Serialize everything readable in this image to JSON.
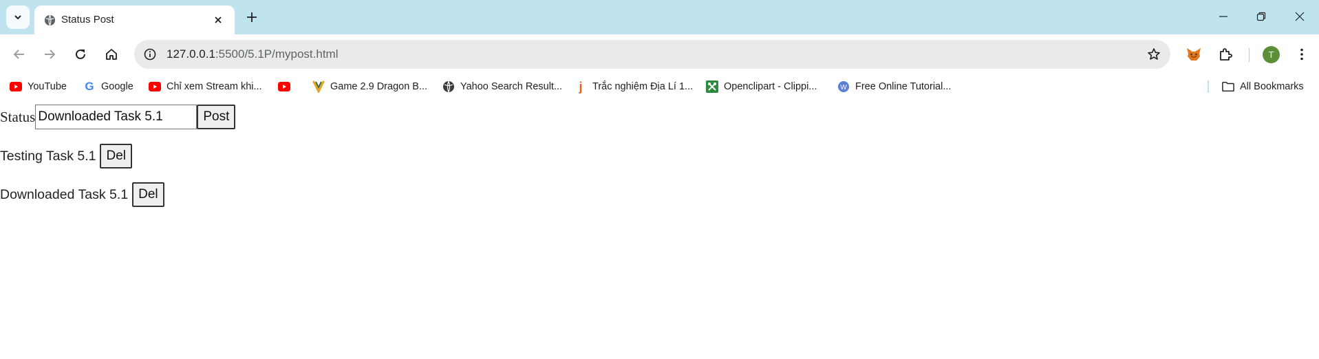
{
  "browser": {
    "tab_title": "Status Post",
    "url_host": "127.0.0.1",
    "url_rest": ":5500/5.1P/mypost.html",
    "avatar_letter": "T",
    "bookmarks": [
      {
        "label": "YouTube",
        "icon": "youtube-icon"
      },
      {
        "label": "Google",
        "icon": "google-icon"
      },
      {
        "label": "Chỉ xem Stream khi...",
        "icon": "youtube-icon"
      },
      {
        "label": "",
        "icon": "youtube-icon"
      },
      {
        "label": "Game 2.9 Dragon B...",
        "icon": "vivaldi-icon"
      },
      {
        "label": "Yahoo Search Result...",
        "icon": "globe-icon"
      },
      {
        "label": "Trắc nghiệm Địa Lí 1...",
        "icon": "j-icon"
      },
      {
        "label": "Openclipart - Clippi...",
        "icon": "openclipart-icon"
      },
      {
        "label": "Free Online Tutorial...",
        "icon": "w-icon"
      }
    ],
    "all_bookmarks_label": "All Bookmarks"
  },
  "page": {
    "status_label": "Status",
    "status_input_value": "Downloaded Task 5.1",
    "post_button_label": "Post",
    "posts": [
      {
        "text": "Testing Task 5.1",
        "delete_label": "Del"
      },
      {
        "text": "Downloaded Task 5.1",
        "delete_label": "Del"
      }
    ]
  },
  "colors": {
    "tabstrip": "#bfe4ef",
    "omnibox": "#e9eaea",
    "avatar": "#5b8f3a"
  }
}
